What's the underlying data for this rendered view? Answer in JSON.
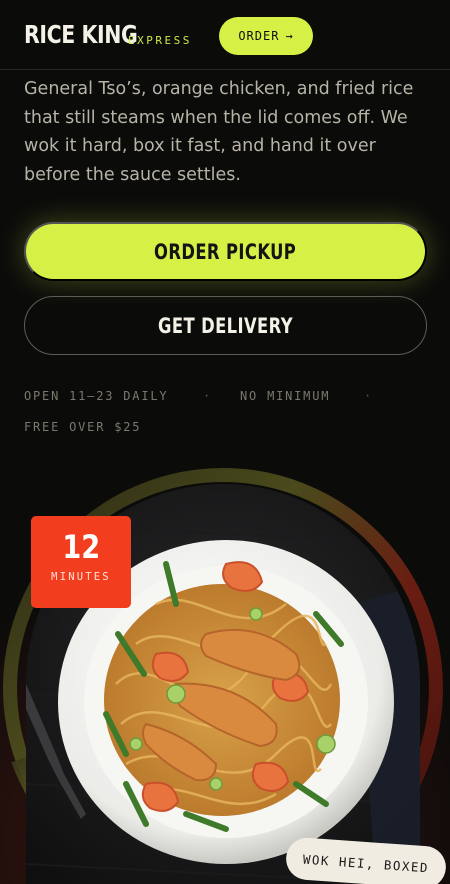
{
  "header": {
    "brand": "RICE KING",
    "brand_sub": "EXPRESS",
    "order_label": "ORDER",
    "order_arrow": "→"
  },
  "hero": {
    "tagline": "General Tso’s, orange chicken, and fried rice that still steams when the lid comes off. We wok it hard, box it fast, and hand it over before the sauce settles."
  },
  "actions": {
    "pickup_label": "ORDER PICKUP",
    "delivery_label": "GET DELIVERY"
  },
  "info": {
    "hours": "OPEN 11–23 DAILY",
    "separator": "·",
    "minimum": "NO MINIMUM",
    "free_delivery": "FREE OVER $25"
  },
  "timer": {
    "value": "12",
    "unit": "MINUTES"
  },
  "sticker": {
    "label": "WOK HEI, BOXED"
  },
  "colors": {
    "accent": "#d6f045",
    "timer_red": "#f23d1f",
    "background": "#0b0b0a",
    "sticker_bg": "#f1ece1"
  },
  "icons": {
    "order_arrow": "arrow-right-icon",
    "dish": "noodle-dish-image"
  }
}
